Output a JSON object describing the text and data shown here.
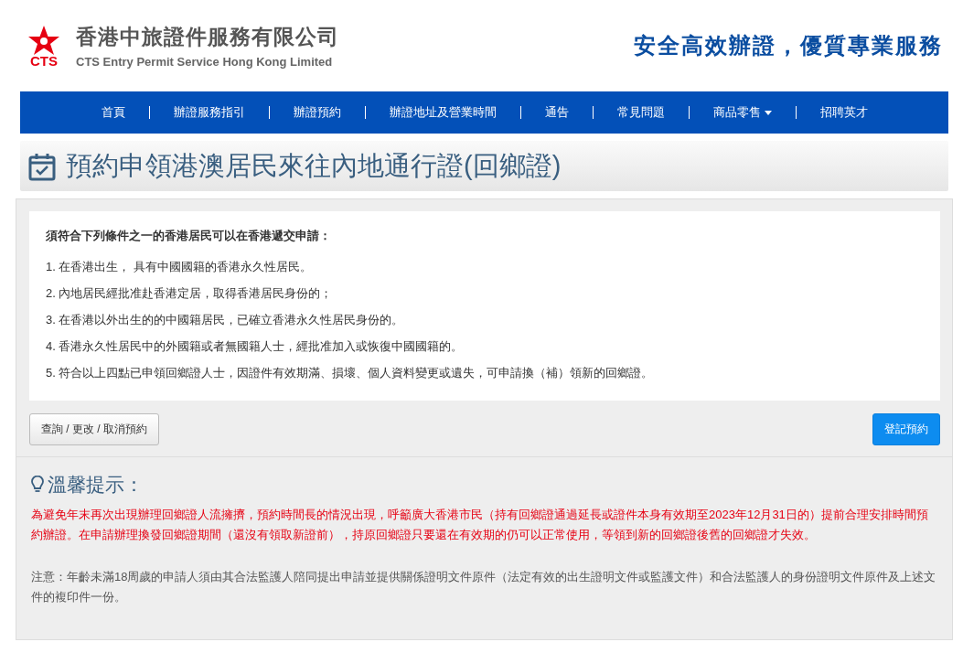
{
  "header": {
    "logo_text": "CTS",
    "company_name": "香港中旅證件服務有限公司",
    "company_name_en": "CTS Entry Permit Service Hong Kong Limited",
    "slogan": "安全高效辦證，優質專業服務"
  },
  "nav": [
    {
      "label": "首頁",
      "dropdown": false
    },
    {
      "label": "辦證服務指引",
      "dropdown": false
    },
    {
      "label": "辦證預約",
      "dropdown": false
    },
    {
      "label": "辦證地址及營業時間",
      "dropdown": false
    },
    {
      "label": "通告",
      "dropdown": false
    },
    {
      "label": "常見問題",
      "dropdown": false
    },
    {
      "label": "商品零售",
      "dropdown": true
    },
    {
      "label": "招聘英才",
      "dropdown": false
    }
  ],
  "page_title": "預約申領港澳居民來往內地通行證(回鄉證)",
  "eligibility": {
    "heading": "須符合下列條件之一的香港居民可以在香港遞交申請：",
    "items": [
      "1. 在香港出生， 具有中國國籍的香港永久性居民。",
      "2. 內地居民經批准赴香港定居，取得香港居民身份的；",
      "3. 在香港以外出生的的中國籍居民，已確立香港永久性居民身份的。",
      "4. 香港永久性居民中的外國籍或者無國籍人士，經批准加入或恢復中國國籍的。",
      "5. 符合以上四點已申領回鄉證人士，因證件有效期滿、損壞、個人資料變更或遺失，可申請換（補）領新的回鄉證。"
    ]
  },
  "buttons": [
    {
      "label": "查詢 / 更改 / 取消預約",
      "kind": "default"
    },
    {
      "label": "登記預約",
      "kind": "primary"
    }
  ],
  "tips": {
    "title": "溫馨提示：",
    "warning": "為避免年末再次出現辦理回鄉證人流擁擠，預約時間長的情況出現，呼籲廣大香港市民（持有回鄉證通過延長或證件本身有效期至2023年12月31日的）提前合理安排時間預約辦證。在申請辦理換發回鄉證期間（還沒有領取新證前），持原回鄉證只要還在有效期的仍可以正常使用，等領到新的回鄉證後舊的回鄉證才失效。",
    "note": "注意：年齡未滿18周歲的申請人須由其合法監護人陪同提出申請並提供關係證明文件原件（法定有效的出生證明文件或監護文件）和合法監護人的身份證明文件原件及上述文件的複印件一份。"
  }
}
